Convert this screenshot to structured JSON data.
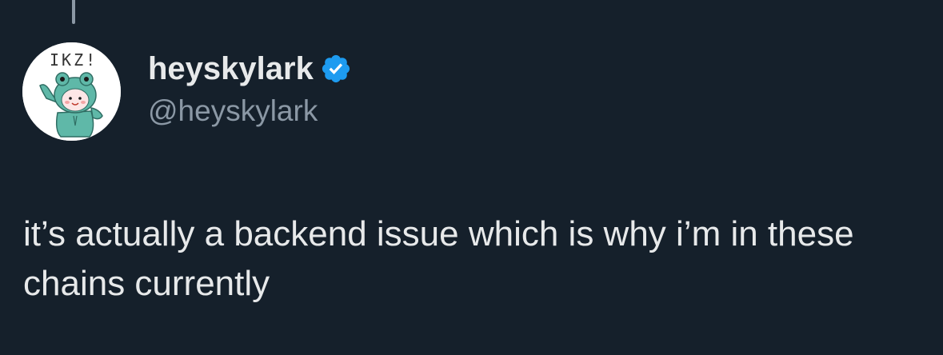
{
  "tweet": {
    "author": {
      "display_name": "heyskylark",
      "handle": "@heyskylark",
      "verified": true,
      "verified_icon": "verified-badge-icon",
      "avatar_text": "IKZ!",
      "avatar_icon": "frog-hood-character-avatar"
    },
    "text": "it’s actually a backend issue which is why i’m in these chains currently"
  },
  "colors": {
    "background": "#15202b",
    "primary_text": "#e7e9ea",
    "secondary_text": "#8b98a5",
    "verified_blue": "#1d9bf0",
    "thread_line": "#8b98a5"
  }
}
